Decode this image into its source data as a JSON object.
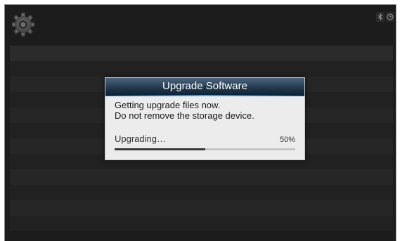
{
  "status_bar": {
    "settings_icon": "gear-icon",
    "icons": [
      "bluetooth-icon",
      "clock-icon"
    ]
  },
  "dialog": {
    "title": "Upgrade Software",
    "message_line1": "Getting upgrade files now.",
    "message_line2": "Do not remove the storage device.",
    "progress_label": "Upgrading…",
    "progress_percent_text": "50%",
    "progress_value": 0.5
  },
  "colors": {
    "background": "#1c1c1c",
    "dialog_bg": "#ececec",
    "title_bar": "#24394d",
    "accent": "#4aa3e0",
    "progress_fill": "#3a3a3a"
  }
}
